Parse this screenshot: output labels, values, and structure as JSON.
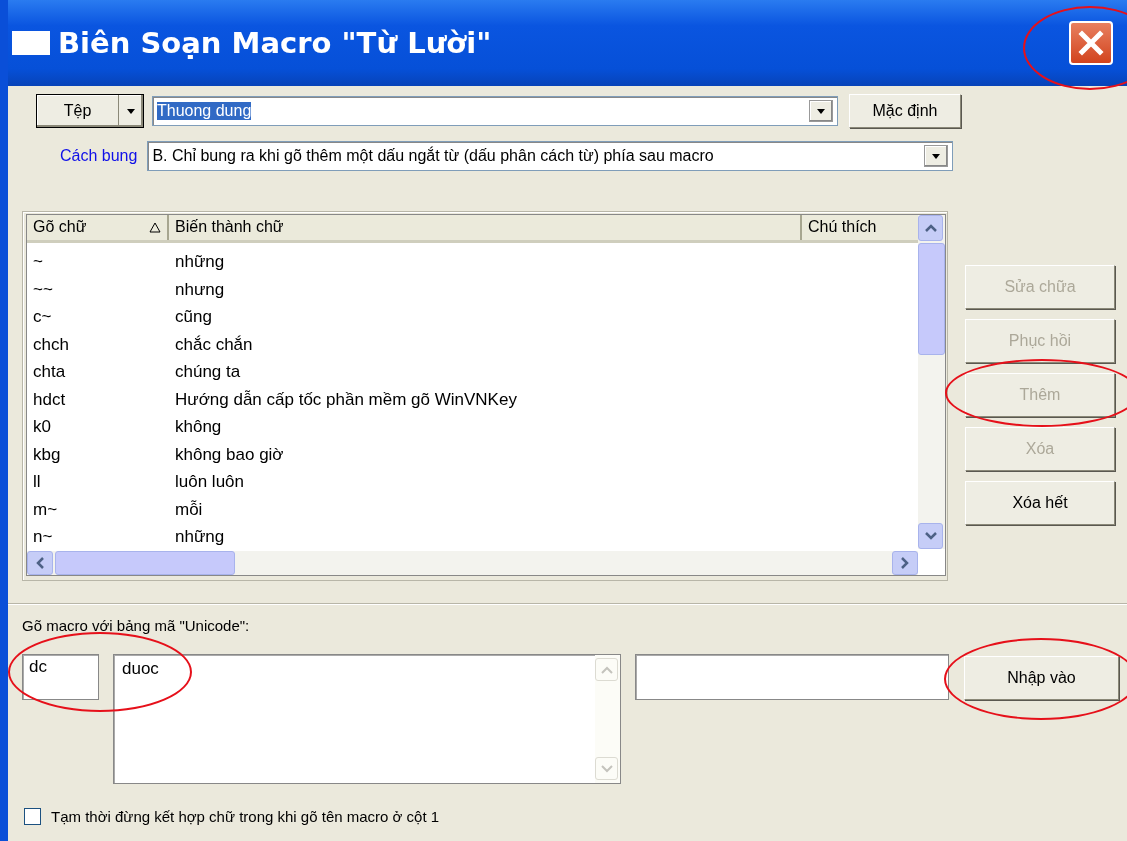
{
  "window": {
    "title": "Biên Soạn Macro \"Từ Lười\"",
    "close_circled": true
  },
  "file_button": {
    "label": "Tệp"
  },
  "macro_file": {
    "value": "Thuong dung",
    "highlighted": true
  },
  "default_button": {
    "label": "Mặc định"
  },
  "expand_mode": {
    "label": "Cách bung",
    "value": "B. Chỉ bung ra khi gõ thêm một dấu ngắt từ (dấu phân cách từ) phía sau macro"
  },
  "table": {
    "columns": [
      {
        "label": "Gõ chữ",
        "sorted": true
      },
      {
        "label": "Biến thành chữ",
        "sorted": false
      },
      {
        "label": "Chú thích",
        "sorted": false
      }
    ],
    "rows": [
      {
        "typed": "~",
        "result": "những"
      },
      {
        "typed": "~~",
        "result": "nhưng"
      },
      {
        "typed": "c~",
        "result": "cũng"
      },
      {
        "typed": "chch",
        "result": "chắc chắn"
      },
      {
        "typed": "chta",
        "result": "chúng ta"
      },
      {
        "typed": "hdct",
        "result": "Hướng dẫn cấp tốc phần mềm gõ WinVNKey"
      },
      {
        "typed": "k0",
        "result": "không"
      },
      {
        "typed": "kbg",
        "result": "không bao giờ"
      },
      {
        "typed": "ll",
        "result": "luôn luôn"
      },
      {
        "typed": "m~",
        "result": "mỗi"
      },
      {
        "typed": "n~",
        "result": "những"
      }
    ]
  },
  "side_buttons": [
    {
      "label": "Sửa chữa",
      "disabled": true,
      "circled": false
    },
    {
      "label": "Phục hồi",
      "disabled": true,
      "circled": false
    },
    {
      "label": "Thêm",
      "disabled": true,
      "circled": true
    },
    {
      "label": "Xóa",
      "disabled": true,
      "circled": false
    },
    {
      "label": "Xóa hết",
      "disabled": false,
      "circled": false
    }
  ],
  "editor": {
    "label": "Gõ macro với bảng mã \"Unicode\":",
    "macro_value": "dc",
    "expansion_value": "duoc",
    "inputs_circled": true,
    "import_button": {
      "label": "Nhập vào",
      "circled": true
    }
  },
  "option": {
    "label": "Tạm thời đừng kết hợp chữ trong khi gõ tên macro ở cột 1",
    "checked": false
  }
}
